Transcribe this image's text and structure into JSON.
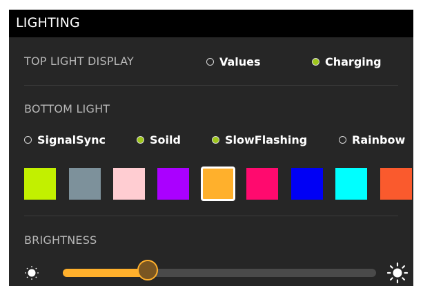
{
  "header": {
    "title": "LIGHTING"
  },
  "top_light": {
    "label": "TOP LIGHT DISPLAY",
    "options": [
      {
        "label": "Values",
        "selected": false
      },
      {
        "label": "Charging",
        "selected": true
      }
    ]
  },
  "bottom_light": {
    "label": "BOTTOM LIGHT",
    "modes": [
      {
        "label": "SignalSync",
        "selected": false
      },
      {
        "label": "Soild",
        "selected": true
      },
      {
        "label": "SlowFlashing",
        "selected": true
      },
      {
        "label": "Rainbow",
        "selected": false
      }
    ],
    "swatches": [
      "#c2f000",
      "#7d919b",
      "#ffcdd2",
      "#aa00ff",
      "#ffb02c",
      "#ff0a6e",
      "#0000f5",
      "#00ffff",
      "#fa5a2d"
    ],
    "selected_swatch": 4
  },
  "brightness": {
    "label": "BRIGHTNESS",
    "value_fraction": 0.27
  },
  "colors": {
    "panel_bg": "#262626",
    "header_bg": "#000000",
    "accent": "#ffb02c",
    "radio_on": "#9ec61b"
  },
  "icons": {
    "low": "sun-dim-icon",
    "high": "sun-bright-icon"
  }
}
